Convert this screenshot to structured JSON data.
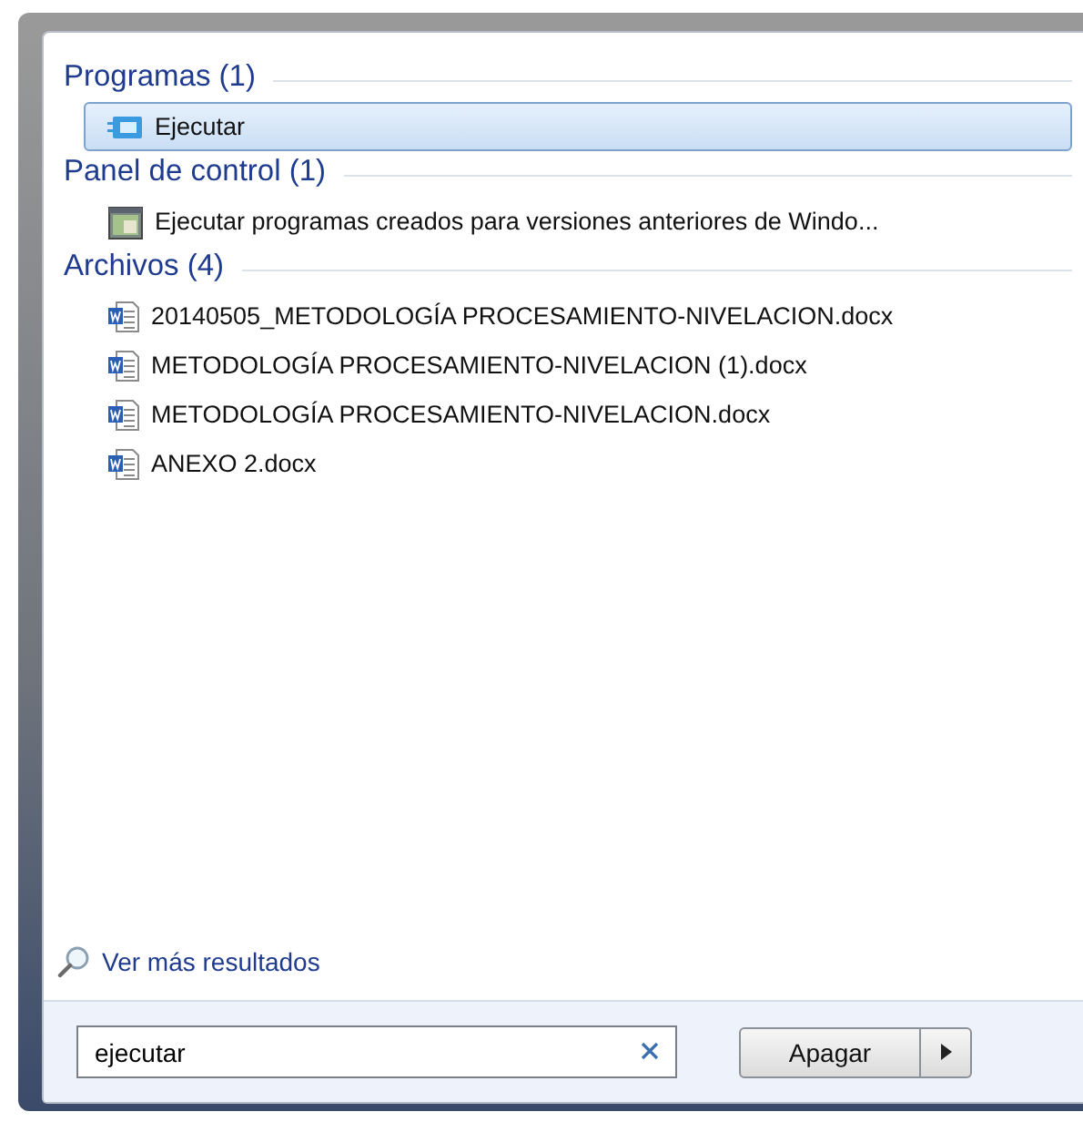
{
  "sections": [
    {
      "title": "Programas (1)",
      "items": [
        {
          "kind": "program",
          "label": "Ejecutar",
          "selected": true
        }
      ]
    },
    {
      "title": "Panel de control (1)",
      "items": [
        {
          "kind": "control",
          "label": "Ejecutar programas creados para versiones anteriores de Windo...",
          "selected": false
        }
      ]
    },
    {
      "title": "Archivos (4)",
      "items": [
        {
          "kind": "document",
          "label": "20140505_METODOLOGÍA PROCESAMIENTO-NIVELACION.docx",
          "selected": false
        },
        {
          "kind": "document",
          "label": "METODOLOGÍA PROCESAMIENTO-NIVELACION (1).docx",
          "selected": false
        },
        {
          "kind": "document",
          "label": "METODOLOGÍA PROCESAMIENTO-NIVELACION.docx",
          "selected": false
        },
        {
          "kind": "document",
          "label": "ANEXO 2.docx",
          "selected": false
        }
      ]
    }
  ],
  "more_results": "Ver más resultados",
  "search": {
    "value": "ejecutar"
  },
  "shutdown_button": "Apagar"
}
